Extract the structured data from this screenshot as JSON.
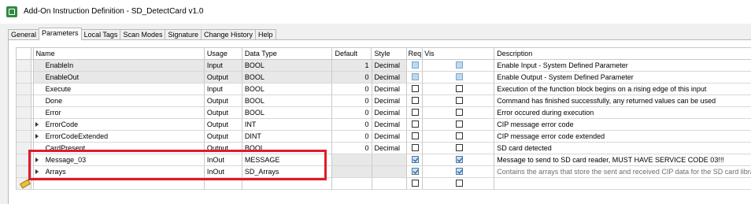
{
  "window": {
    "title": "Add-On Instruction Definition - SD_DetectCard v1.0"
  },
  "tabs": [
    {
      "label": "General",
      "active": false
    },
    {
      "label": "Parameters",
      "active": true
    },
    {
      "label": "Local Tags",
      "active": false
    },
    {
      "label": "Scan Modes",
      "active": false
    },
    {
      "label": "Signature",
      "active": false
    },
    {
      "label": "Change History",
      "active": false
    },
    {
      "label": "Help",
      "active": false
    }
  ],
  "grid": {
    "headers": {
      "name": "Name",
      "usage": "Usage",
      "type": "Data Type",
      "default": "Default",
      "style": "Style",
      "req": "Req",
      "vis": "Vis",
      "description": "Description"
    },
    "rows": [
      {
        "name": "EnableIn",
        "usage": "Input",
        "type": "BOOL",
        "default": "1",
        "style": "Decimal",
        "req": "disabled",
        "vis": "disabled",
        "description": "Enable Input - System Defined Parameter",
        "expandable": false
      },
      {
        "name": "EnableOut",
        "usage": "Output",
        "type": "BOOL",
        "default": "0",
        "style": "Decimal",
        "req": "disabled",
        "vis": "disabled",
        "description": "Enable Output - System Defined Parameter",
        "expandable": false
      },
      {
        "name": "Execute",
        "usage": "Input",
        "type": "BOOL",
        "default": "0",
        "style": "Decimal",
        "req": "unchecked",
        "vis": "unchecked",
        "description": "Execution of the function block begins on a rising edge of this input",
        "expandable": false
      },
      {
        "name": "Done",
        "usage": "Output",
        "type": "BOOL",
        "default": "0",
        "style": "Decimal",
        "req": "unchecked",
        "vis": "unchecked",
        "description": "Command has finished successfully, any returned values can be used",
        "expandable": false
      },
      {
        "name": "Error",
        "usage": "Output",
        "type": "BOOL",
        "default": "0",
        "style": "Decimal",
        "req": "unchecked",
        "vis": "unchecked",
        "description": "Error occured during execution",
        "expandable": false
      },
      {
        "name": "ErrorCode",
        "usage": "Output",
        "type": "INT",
        "default": "0",
        "style": "Decimal",
        "req": "unchecked",
        "vis": "unchecked",
        "description": "CIP message error code",
        "expandable": true
      },
      {
        "name": "ErrorCodeExtended",
        "usage": "Output",
        "type": "DINT",
        "default": "0",
        "style": "Decimal",
        "req": "unchecked",
        "vis": "unchecked",
        "description": "CIP message error code extended",
        "expandable": true
      },
      {
        "name": "CardPresent",
        "usage": "Output",
        "type": "BOOL",
        "default": "0",
        "style": "Decimal",
        "req": "unchecked",
        "vis": "unchecked",
        "description": "SD card detected",
        "expandable": false
      },
      {
        "name": "Message_03",
        "usage": "InOut",
        "type": "MESSAGE",
        "default": "",
        "style": "",
        "req": "checked",
        "vis": "checked",
        "description": "Message to send to SD card reader, MUST HAVE SERVICE CODE 03!!!",
        "expandable": true
      },
      {
        "name": "Arrays",
        "usage": "InOut",
        "type": "SD_Arrays",
        "default": "",
        "style": "",
        "req": "checked",
        "vis": "checked",
        "description": "Contains the arrays that store the sent and received CIP data for the SD card library",
        "expandable": true
      },
      {
        "name": "",
        "usage": "",
        "type": "",
        "default": "",
        "style": "",
        "req": "unchecked",
        "vis": "unchecked",
        "description": "",
        "expandable": false,
        "new_row": true
      }
    ]
  },
  "colors": {
    "highlight": "#e01b2a",
    "system_row": "#e8e8e8",
    "checkbox_disabled": "#bcd9f2"
  }
}
